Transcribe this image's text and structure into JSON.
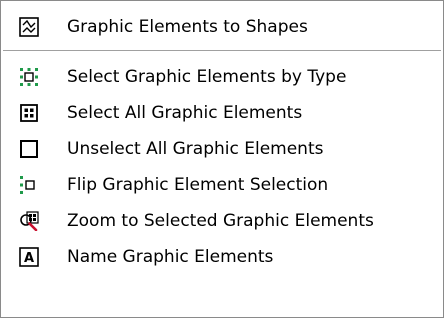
{
  "menu": {
    "items": [
      {
        "label": "Graphic Elements to Shapes",
        "icon": "graphic-to-shapes-icon"
      },
      {
        "label": "Select Graphic Elements by Type",
        "icon": "select-by-type-icon"
      },
      {
        "label": "Select All Graphic Elements",
        "icon": "select-all-icon"
      },
      {
        "label": "Unselect All Graphic Elements",
        "icon": "unselect-all-icon"
      },
      {
        "label": "Flip Graphic Element Selection",
        "icon": "flip-selection-icon"
      },
      {
        "label": "Zoom to Selected Graphic Elements",
        "icon": "zoom-to-selected-icon"
      },
      {
        "label": "Name Graphic Elements",
        "icon": "name-elements-icon"
      }
    ]
  },
  "icons": {
    "name_glyph": "A"
  },
  "colors": {
    "menu_background": "#ffffff",
    "separator": "#a0a0a0",
    "selection_green": "#1f9a4a",
    "zoom_red": "#c8102e",
    "text": "#000000"
  }
}
